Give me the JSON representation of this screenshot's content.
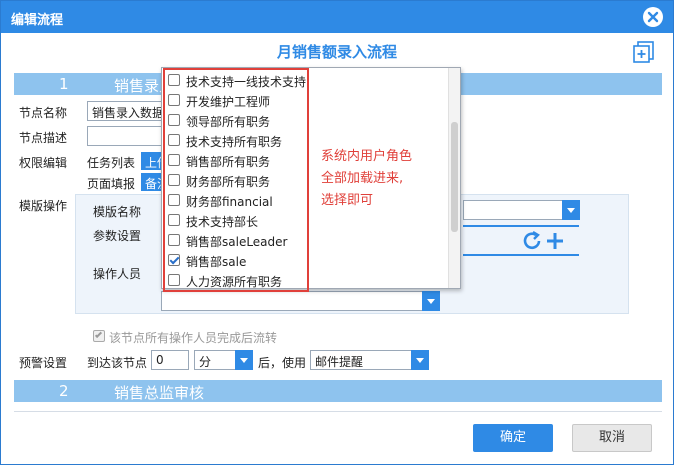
{
  "window": {
    "title": "编辑流程"
  },
  "form": {
    "title": "月销售额录入流程"
  },
  "section1": {
    "num": "1",
    "name": "销售录入"
  },
  "section2": {
    "num": "2",
    "name": "销售总监审核"
  },
  "fields": {
    "node_name_label": "节点名称",
    "node_name_value": "销售录入数据",
    "node_desc_label": "节点描述",
    "permission_label": "权限编辑",
    "task_list_label": "任务列表",
    "task_list_btn": "上传",
    "page_fill_label": "页面填报",
    "page_fill_btn": "备注",
    "template_op_label": "模版操作",
    "template_name_label": "模版名称",
    "param_setting_label": "参数设置",
    "operator_label": "操作人员"
  },
  "flow_checkbox": {
    "label": "该节点所有操作人员完成后流转",
    "checked": true
  },
  "warning": {
    "label": "预警设置",
    "reach_label": "到达该节点",
    "value": "0",
    "unit": "分",
    "after_label": "后，使用",
    "method": "邮件提醒"
  },
  "dropdown": {
    "items": [
      {
        "label": "技术支持一线技术支持",
        "checked": false
      },
      {
        "label": "开发维护工程师",
        "checked": false
      },
      {
        "label": "领导部所有职务",
        "checked": false
      },
      {
        "label": "技术支持所有职务",
        "checked": false
      },
      {
        "label": "销售部所有职务",
        "checked": false
      },
      {
        "label": "财务部所有职务",
        "checked": false
      },
      {
        "label": "财务部financial",
        "checked": false
      },
      {
        "label": "技术支持部长",
        "checked": false
      },
      {
        "label": "销售部saleLeader",
        "checked": false
      },
      {
        "label": "销售部sale",
        "checked": true
      },
      {
        "label": "人力资源所有职务",
        "checked": false
      }
    ]
  },
  "annotation": {
    "line1": "系统内用户角色",
    "line2": "全部加载进来,",
    "line3": "选择即可"
  },
  "buttons": {
    "ok": "确定",
    "cancel": "取消"
  },
  "colors": {
    "accent": "#2f8ae5",
    "section": "#8ec3ee",
    "annotation": "#e0403a"
  }
}
